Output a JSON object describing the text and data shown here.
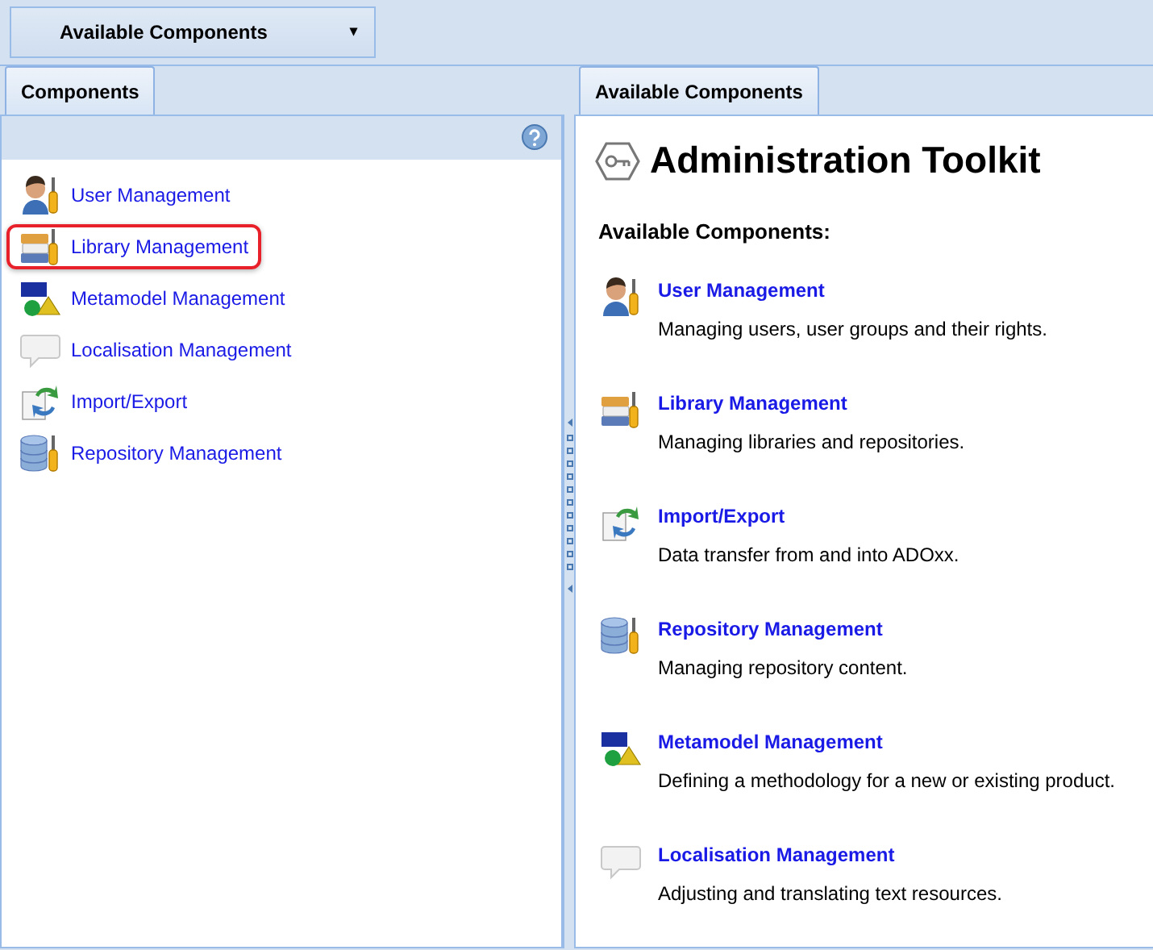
{
  "toolbar": {
    "dropdown": {
      "label": "Available Components",
      "caret": "▾"
    }
  },
  "left_panel": {
    "tab": {
      "label": "Components",
      "selected": true
    },
    "items": [
      {
        "kind": "user",
        "label": "User Management",
        "selected": false
      },
      {
        "kind": "library",
        "label": "Library Management",
        "selected": true
      },
      {
        "kind": "metamodel",
        "label": "Metamodel Management",
        "selected": false
      },
      {
        "kind": "localisation",
        "label": "Localisation Management",
        "selected": false
      },
      {
        "kind": "importexport",
        "label": "Import/Export",
        "selected": false
      },
      {
        "kind": "repository",
        "label": "Repository Management",
        "selected": false
      }
    ]
  },
  "right_panel": {
    "tab": {
      "label": "Available Components",
      "selected": true
    },
    "title": "Administration Toolkit",
    "subtitle": "Available Components:",
    "components": [
      {
        "kind": "user",
        "title": "User Management",
        "description": "Managing users, user groups and their rights."
      },
      {
        "kind": "library",
        "title": "Library Management",
        "description": "Managing libraries and repositories."
      },
      {
        "kind": "importexport",
        "title": "Import/Export",
        "description": "Data transfer from and into ADOxx."
      },
      {
        "kind": "repository",
        "title": "Repository Management",
        "description": "Managing repository content."
      },
      {
        "kind": "metamodel",
        "title": "Metamodel Management",
        "description": "Defining a methodology for a new or existing product."
      },
      {
        "kind": "localisation",
        "title": "Localisation Management",
        "description": "Adjusting and translating text resources."
      }
    ]
  }
}
